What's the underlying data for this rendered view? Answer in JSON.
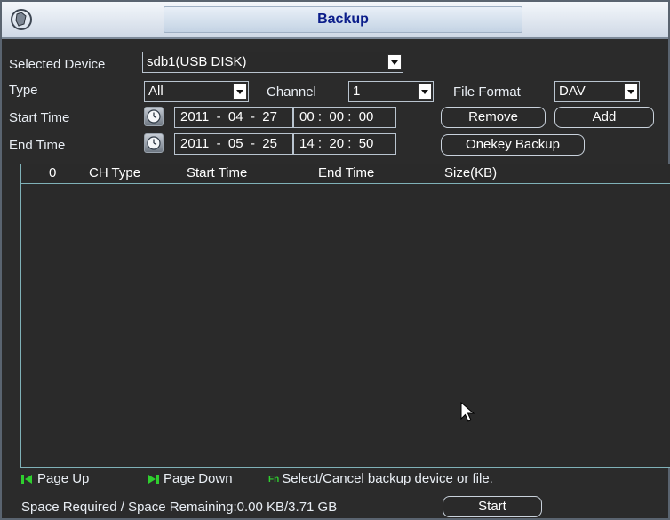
{
  "window": {
    "title": "Backup"
  },
  "device": {
    "label": "Selected Device",
    "value": "sdb1(USB DISK)"
  },
  "type": {
    "label": "Type",
    "value": "All"
  },
  "channel": {
    "label": "Channel",
    "value": "1"
  },
  "file_format": {
    "label": "File Format",
    "value": "DAV"
  },
  "start_time": {
    "label": "Start Time",
    "date": "2011  -  04  -  27",
    "time": "00 :  00 :  00"
  },
  "end_time": {
    "label": "End Time",
    "date": "2011  -  05  -  25",
    "time": "14 :  20 :  50"
  },
  "buttons": {
    "remove": "Remove",
    "add": "Add",
    "onekey": "Onekey Backup",
    "start": "Start"
  },
  "table": {
    "headers": {
      "index": "0",
      "ch_type": "CH  Type",
      "start_time": "Start Time",
      "end_time": "End Time",
      "size": "Size(KB)"
    },
    "rows": []
  },
  "legend": {
    "page_up": "Page Up",
    "page_down": "Page Down",
    "fn_hint": "Select/Cancel backup device or file.",
    "fn_key": "Fn"
  },
  "status": {
    "space": "Space Required / Space Remaining:0.00 KB/3.71 GB"
  },
  "colors": {
    "title_text": "#0b1d8a",
    "legend_key": "#2fcf2f",
    "table_border": "#7fb1b8"
  },
  "icons": [
    "app-logo-icon",
    "clock-icon",
    "chevron-down-icon",
    "page-up-icon",
    "page-down-icon",
    "fn-key-icon",
    "mouse-cursor-icon"
  ]
}
